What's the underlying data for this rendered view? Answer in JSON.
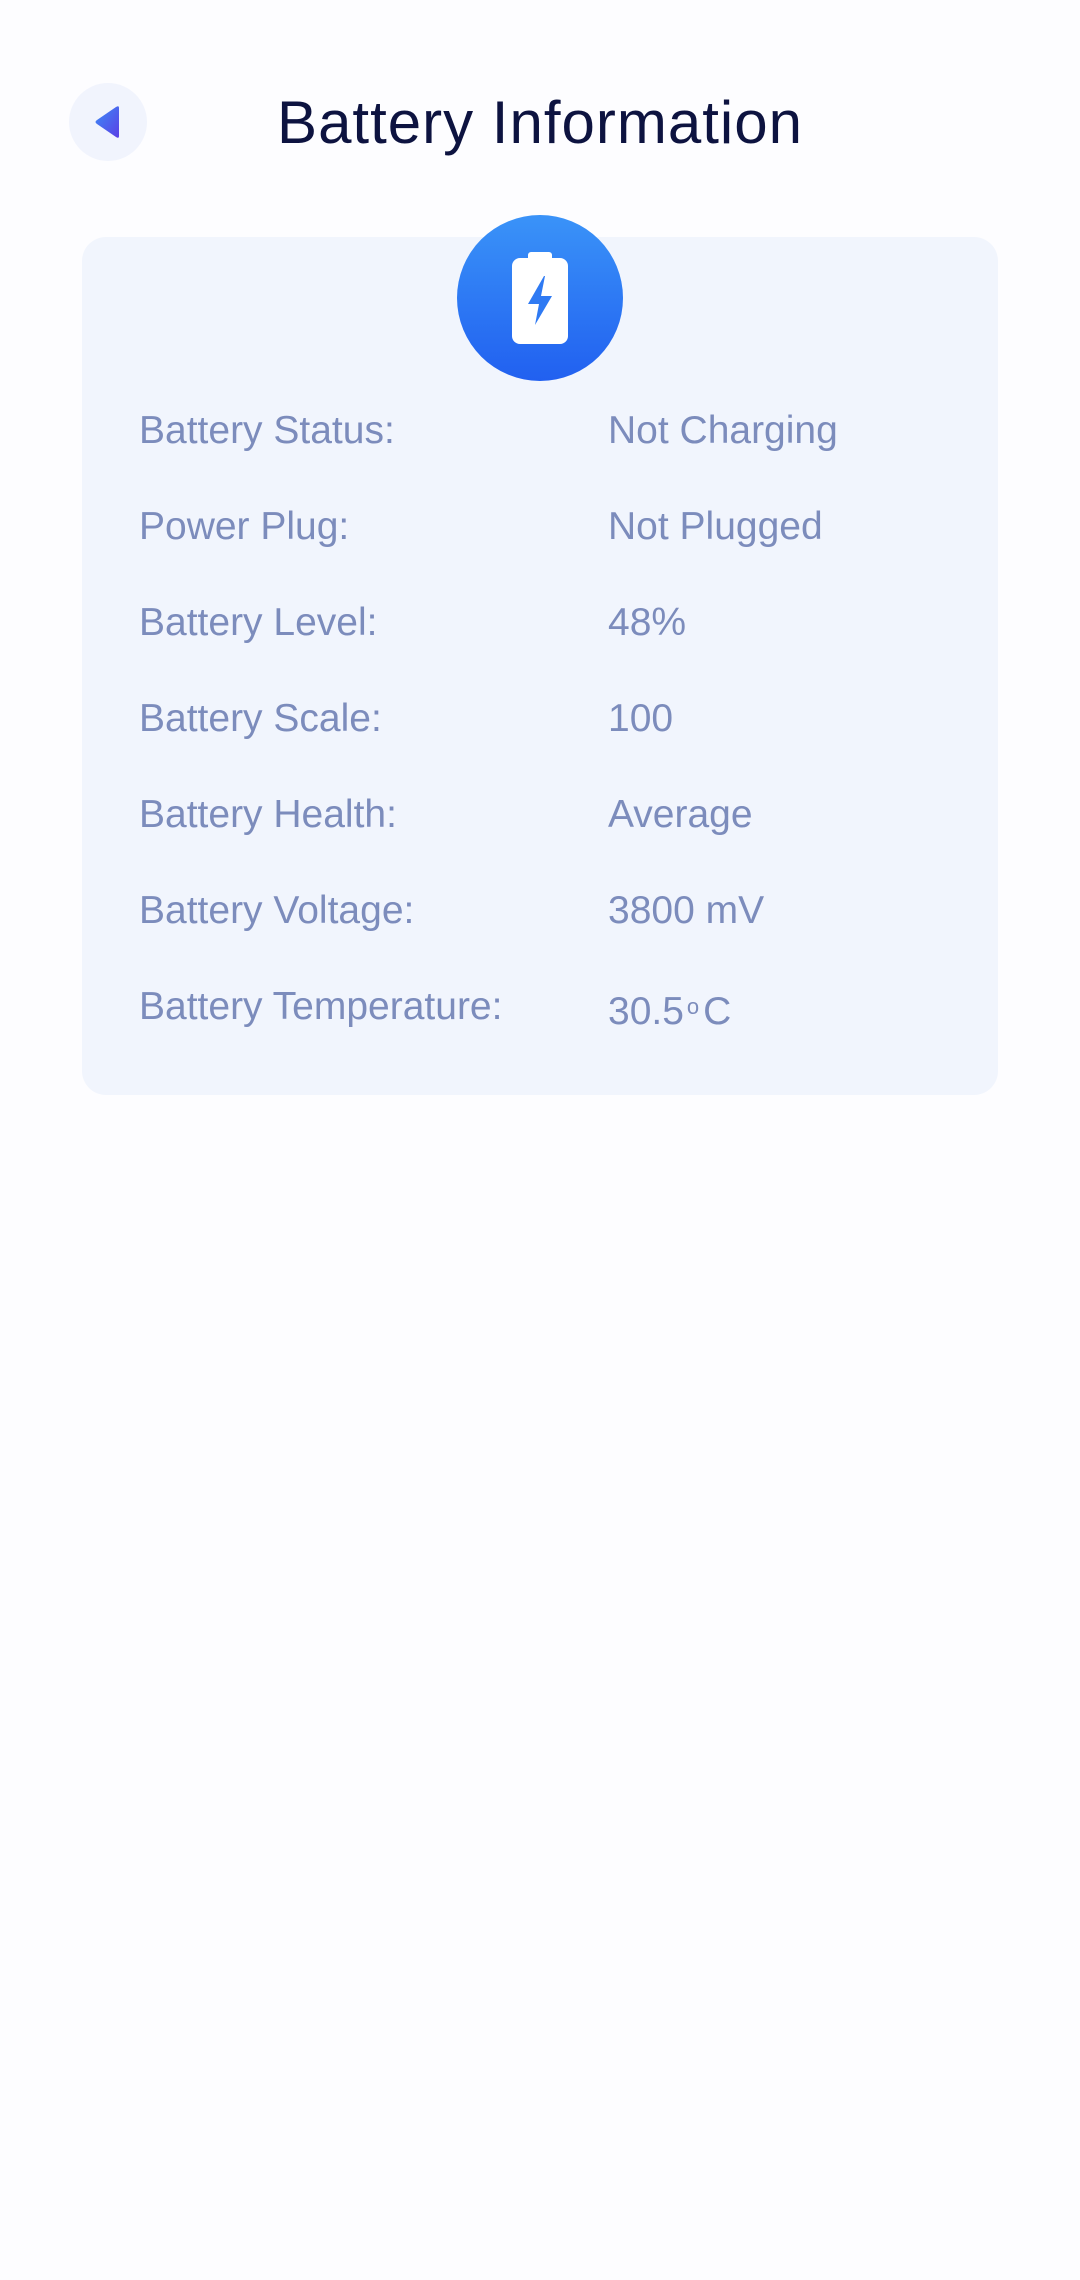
{
  "header": {
    "title": "Battery Information",
    "back_icon": "back-arrow-icon"
  },
  "card": {
    "icon": "battery-charging-icon",
    "accent_colors": [
      "#3a93f8",
      "#2160f0"
    ],
    "rows": [
      {
        "label": "Battery Status:",
        "value": "Not Charging"
      },
      {
        "label": "Power Plug:",
        "value": "Not Plugged"
      },
      {
        "label": "Battery Level:",
        "value": "48%"
      },
      {
        "label": "Battery Scale:",
        "value": "100"
      },
      {
        "label": "Battery Health:",
        "value": "Average"
      },
      {
        "label": "Battery Voltage:",
        "value": "3800 mV"
      },
      {
        "label": "Battery Temperature:",
        "value_number": "30.5",
        "value_degree": "o",
        "value_unit": "C"
      }
    ]
  },
  "colors": {
    "title": "#0d1340",
    "text": "#7c8cbc",
    "card_bg": "#f1f5fd",
    "back_bg": "#f1f4fd"
  }
}
